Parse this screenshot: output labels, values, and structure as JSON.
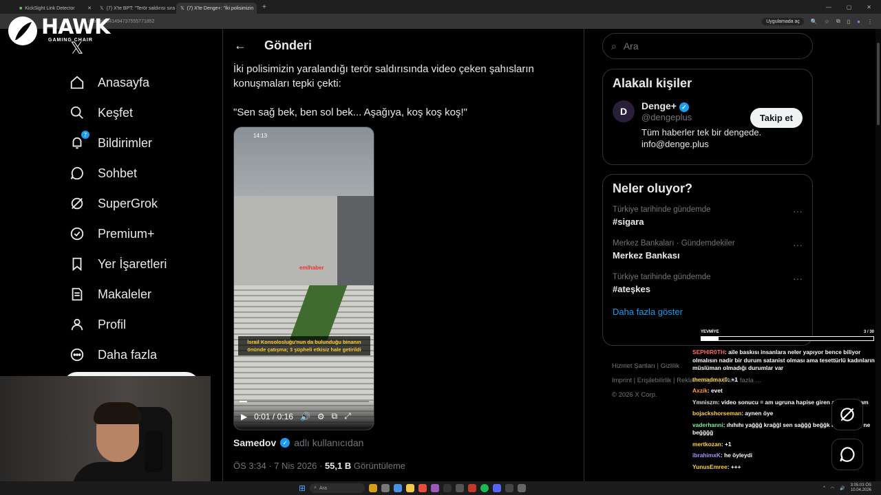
{
  "browser": {
    "tabs": [
      {
        "title": "KickSight Link Detector",
        "active": false
      },
      {
        "title": "(7) X'te BPT: \"Terör saldırısı sıra",
        "active": false
      },
      {
        "title": "(7) X'te Denge+: \"İki polisimizin",
        "active": true
      }
    ],
    "new_tab": "+",
    "url": "/status/2041494737555771852",
    "open_in_app": "Uygulamada aç"
  },
  "logo": {
    "brand": "HAWK",
    "sub": "GAMING CHAIR"
  },
  "nav": {
    "items": [
      {
        "label": "Anasayfa",
        "icon": "home-icon"
      },
      {
        "label": "Keşfet",
        "icon": "search-icon"
      },
      {
        "label": "Bildirimler",
        "icon": "bell-icon",
        "badge": "7"
      },
      {
        "label": "Sohbet",
        "icon": "chat-icon"
      },
      {
        "label": "SuperGrok",
        "icon": "grok-icon"
      },
      {
        "label": "Premium+",
        "icon": "verified-badge-icon"
      },
      {
        "label": "Yer İşaretleri",
        "icon": "bookmark-icon"
      },
      {
        "label": "Makaleler",
        "icon": "article-icon"
      },
      {
        "label": "Profil",
        "icon": "person-icon"
      },
      {
        "label": "Daha fazla",
        "icon": "more-circle-icon"
      }
    ]
  },
  "post": {
    "header_title": "Gönderi",
    "text_line1": "İki polisimizin yaralandığı terör saldırısında video çeken şahısların",
    "text_line2": "konuşmaları tepki çekti:",
    "text_quote": "\"Sen sağ bek, ben sol bek... Aşağıya, koş koş koş!\"",
    "video": {
      "phone_time": "14:13",
      "watermark": "emlhaber",
      "caption_line1": "İsrail Konsolosluğu'nun da bulunduğu binanın",
      "caption_line2": "önünde çatışma; 3 şüpheli etkisiz hale getirildi",
      "time": "0:01 / 0:16",
      "progress": 0.06
    },
    "source_user": "Samedov",
    "source_suffix": "adlı kullanıcıdan",
    "timestamp": "ÖS 3:34 · 7 Nis 2026 · ",
    "views": "55,1 B",
    "views_label": "Görüntüleme"
  },
  "right": {
    "search_placeholder": "Ara",
    "related": {
      "title": "Alakalı kişiler",
      "name": "Denge+",
      "handle": "@dengeplus",
      "bio_line1": "Tüm haberler tek bir dengede.",
      "bio_line2": "info@denge.plus",
      "follow_label": "Takip et"
    },
    "trends": {
      "title": "Neler oluyor?",
      "items": [
        {
          "category": "Türkiye tarihinde gündemde",
          "name": "#sigara"
        },
        {
          "category": "Merkez Bankaları · Gündemdekiler",
          "name": "Merkez Bankası"
        },
        {
          "category": "Türkiye tarihinde gündemde",
          "name": "#ateşkes"
        }
      ],
      "more": "Daha fazla göster"
    },
    "footer": {
      "line1": "Hizmet Şartları   |   Gizlilik",
      "line2": "Imprint   |   Erişilebilirlik   |   Reklam bilgisi   |   Daha fazla ...",
      "line3": "© 2026 X Corp."
    }
  },
  "overlay": {
    "bar_label": "YEVMİYE",
    "bar_count": "3 / 30",
    "bar_progress": 0.1,
    "chat": [
      {
        "user": "SEPHIR0TH",
        "color": "#ff6b6b",
        "text": ": aile baskısı insanlara neler yapıyor bence biliyor olmalısın nadir bir durum satanist olması ama tesettürlü kadınların müslüman olmadığı durumlar var"
      },
      {
        "user": "themadmax0",
        "color": "#ffd24d",
        "text": ": +1"
      },
      {
        "user": "Axzik",
        "color": "#ff9f43",
        "text": ": evet"
      },
      {
        "user": "Ymniszm",
        "color": "#e0e0e0",
        "text": ": video sonucu = am ugruna hapise giren avel bir adam"
      },
      {
        "user": "bojackshorseman",
        "color": "#ffd24d",
        "text": ": aynen öye"
      },
      {
        "user": "vaderhanni",
        "color": "#7bed9f",
        "text": ": ıhıhıhı yağğğ krağğl sen sağğğ beğğk ben ığğ sol ne beğğğğ"
      },
      {
        "user": "mertkozan",
        "color": "#ffd24d",
        "text": ": +1"
      },
      {
        "user": "ibrahimxK",
        "color": "#a29bfe",
        "text": ": he öyleydi"
      },
      {
        "user": "YunusEmree",
        "color": "#ffd24d",
        "text": ": +++"
      }
    ]
  },
  "taskbar": {
    "search": "Ara",
    "time": "3:05:03 ÖS",
    "date": "10.04.2026"
  }
}
